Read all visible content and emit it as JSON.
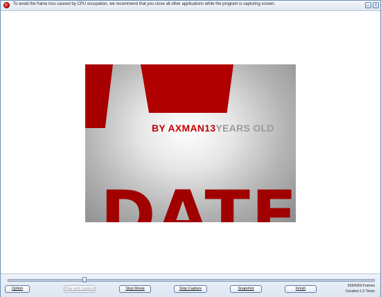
{
  "titlebar": {
    "text": "To avoid the frame loss caused by CPU occupation, we recommend that you close all other applications while the program is capturing screen."
  },
  "preview": {
    "byline_red": "BY AXMAN13",
    "byline_gray": "YEARS OLD",
    "big_word": "DATE"
  },
  "controls": {
    "option": "Option",
    "play_and_capture": "Play and Capture",
    "stop_movie": "Stop Movie",
    "stop_capture": "Stop Capture",
    "snapshot": "Snapshot",
    "finish": "Finish"
  },
  "status": {
    "frames": "928/4369 Frames",
    "duration": "Duration:1.0 Times"
  },
  "slider": {
    "position_fraction": 0.21
  }
}
